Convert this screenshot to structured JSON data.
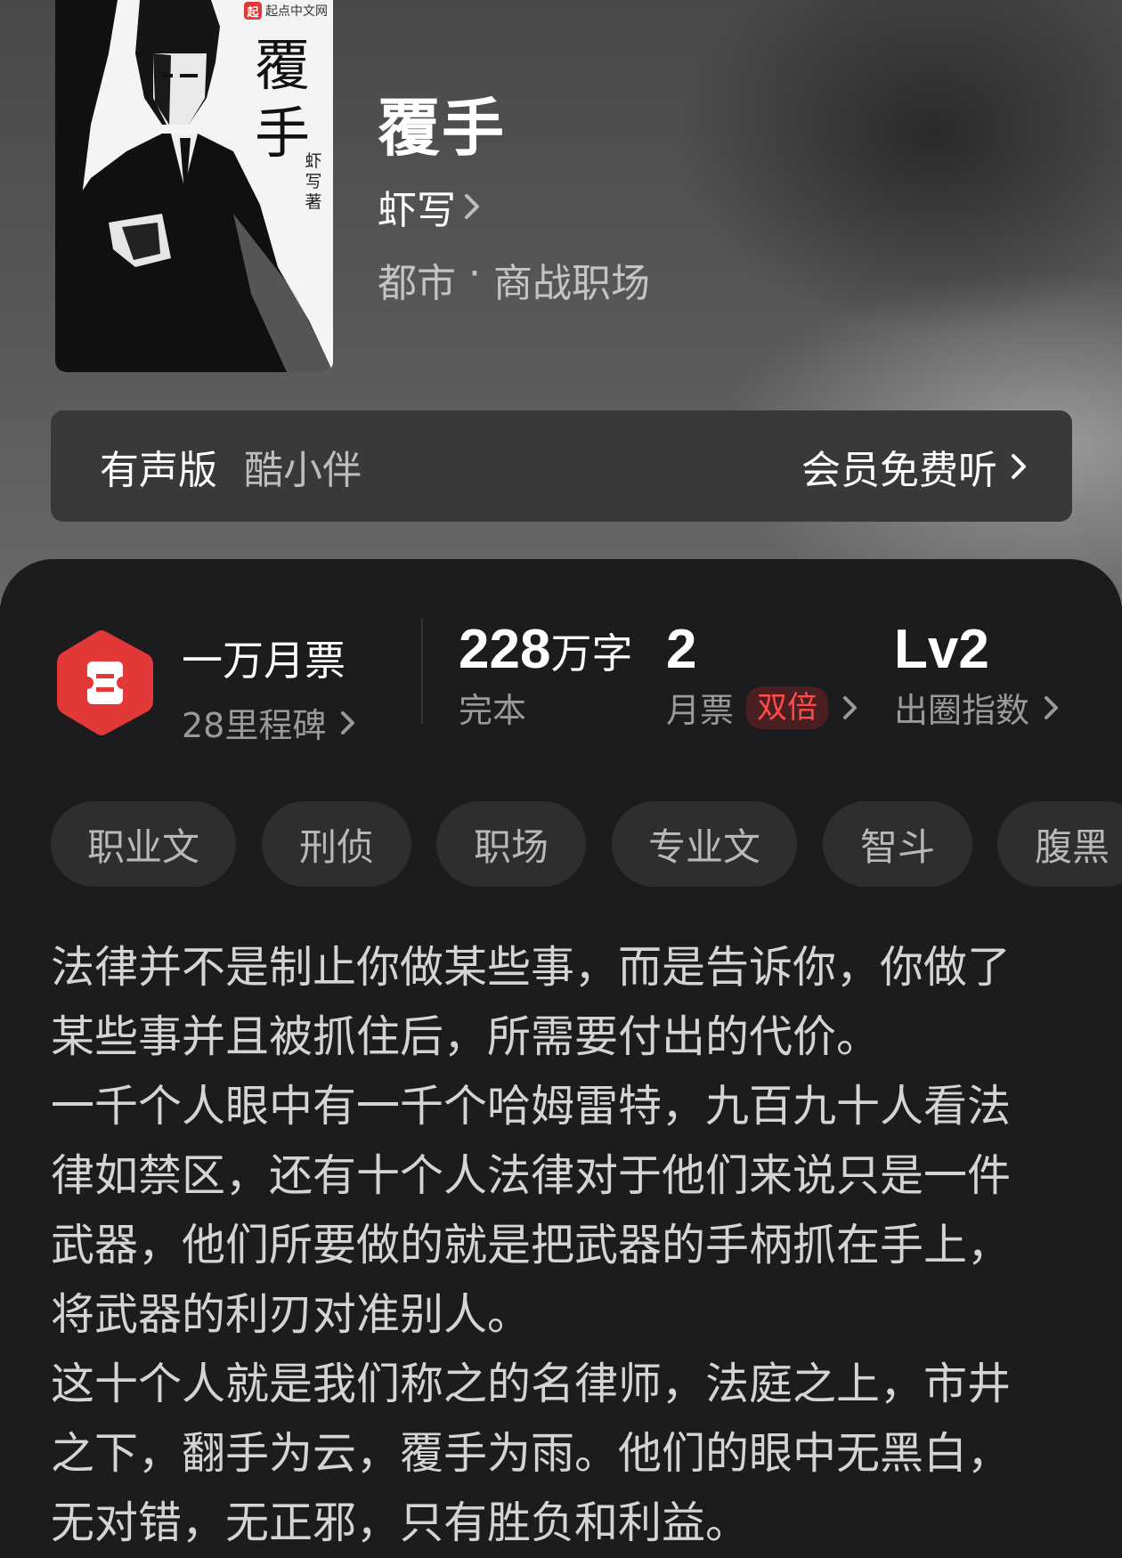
{
  "book": {
    "title": "覆手",
    "author": "虾写",
    "genre": "都市",
    "separator": "·",
    "subgenre": "商战职场"
  },
  "cover": {
    "logo_mark": "起",
    "logo_text": "起点中文网",
    "title_line1": "覆",
    "title_line2": "手",
    "author_vertical": "虾写著"
  },
  "audio": {
    "label": "有声版",
    "narrator": "酷小伴",
    "cta": "会员免费听"
  },
  "stats": {
    "milestone_title": "一万月票",
    "milestone_sub": "28里程碑",
    "words_number": "228",
    "words_unit": "万字",
    "words_status": "完本",
    "tickets_number": "2",
    "tickets_label": "月票",
    "tickets_badge": "双倍",
    "level": "Lv2",
    "level_label": "出圈指数"
  },
  "tags": [
    "职业文",
    "刑侦",
    "职场",
    "专业文",
    "智斗",
    "腹黑"
  ],
  "synopsis": [
    "法律并不是制止你做某些事，而是告诉你，你做了某些事并且被抓住后，所需要付出的代价。",
    "一千个人眼中有一千个哈姆雷特，九百九十人看法律如禁区，还有十个人法律对于他们来说只是一件武器，他们所要做的就是把武器的手柄抓在手上，将武器的利刃对准别人。",
    "这十个人就是我们称之的名律师，法庭之上，市井之下，翻手为云，覆手为雨。他们的眼中无黑白，无对错，无正邪，只有胜负和利益。"
  ],
  "colors": {
    "accent_red": "#e23838",
    "badge_red": "#ff4b4b",
    "panel_bg": "#1c1c1e",
    "tag_bg": "#2e2e30"
  }
}
